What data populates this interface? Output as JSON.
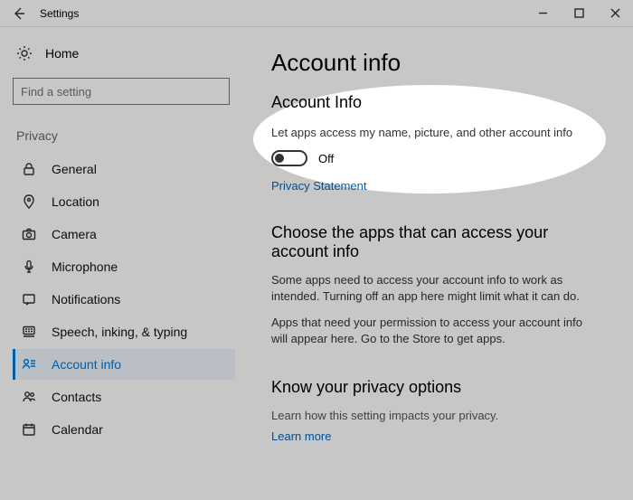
{
  "titlebar": {
    "title": "Settings"
  },
  "sidebar": {
    "home_label": "Home",
    "search_placeholder": "Find a setting",
    "group_label": "Privacy",
    "items": [
      {
        "label": "General"
      },
      {
        "label": "Location"
      },
      {
        "label": "Camera"
      },
      {
        "label": "Microphone"
      },
      {
        "label": "Notifications"
      },
      {
        "label": "Speech, inking, & typing"
      },
      {
        "label": "Account info"
      },
      {
        "label": "Contacts"
      },
      {
        "label": "Calendar"
      }
    ],
    "active_index": 6
  },
  "main": {
    "page_title": "Account info",
    "section1_title": "Account Info",
    "toggle_desc": "Let apps access my name, picture, and other account info",
    "toggle_state_label": "Off",
    "toggle_value": false,
    "privacy_link": "Privacy Statement",
    "section2_title": "Choose the apps that can access your account info",
    "section2_desc1": "Some apps need to access your account info to work as intended. Turning off an app here might limit what it can do.",
    "section2_desc2": "Apps that need your permission to access your account info will appear here. Go to the Store to get apps.",
    "section3_title": "Know your privacy options",
    "section3_desc": "Learn how this setting impacts your privacy.",
    "learn_more_link": "Learn more"
  },
  "colors": {
    "accent": "#0078d7",
    "link": "#0067c0"
  }
}
